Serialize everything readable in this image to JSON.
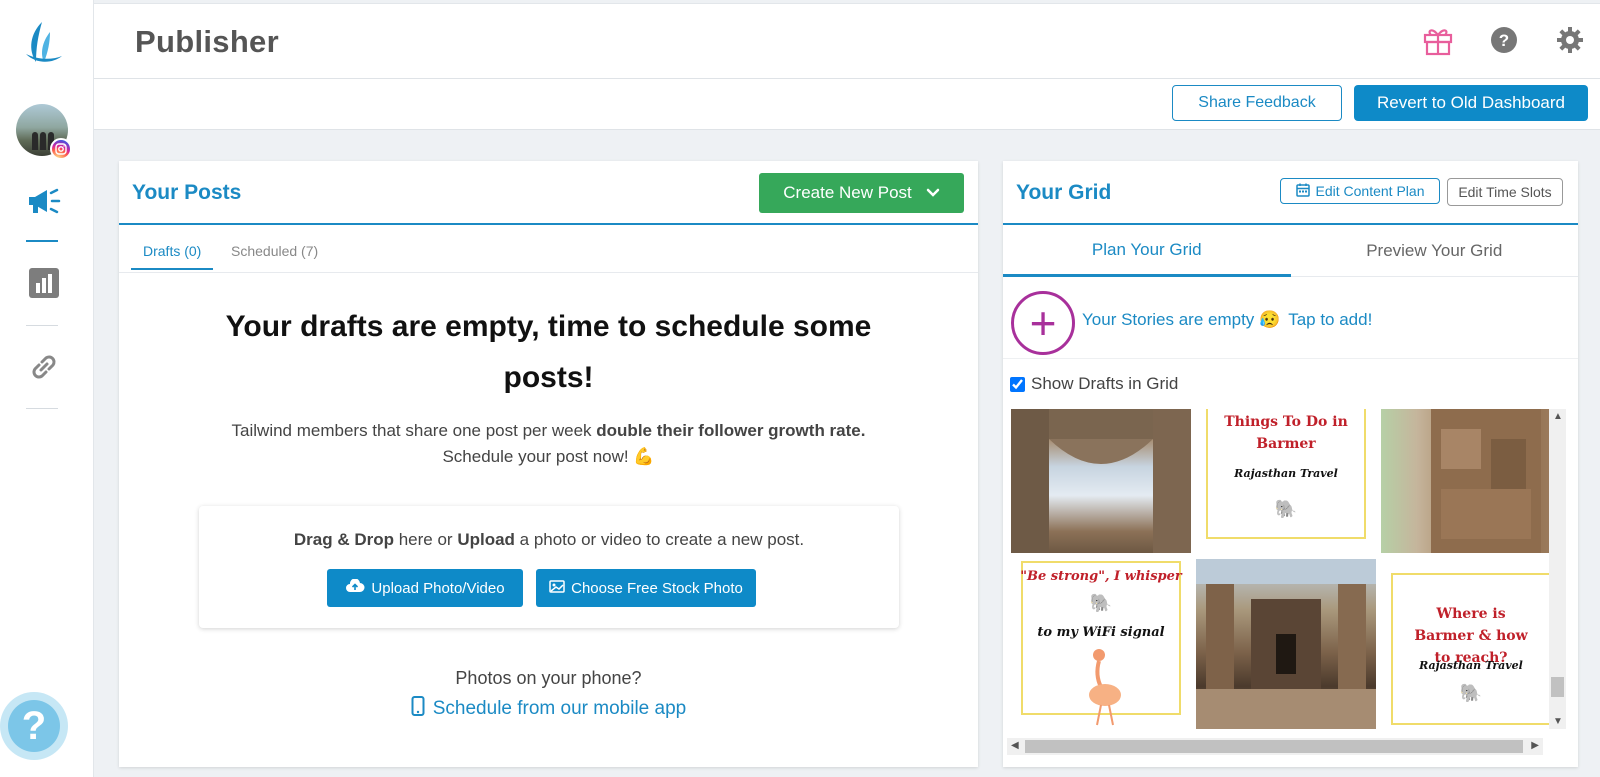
{
  "header": {
    "title": "Publisher",
    "share_feedback": "Share Feedback",
    "revert": "Revert to Old Dashboard"
  },
  "posts": {
    "title": "Your Posts",
    "create_button": "Create New Post",
    "tabs": [
      {
        "label": "Drafts (0)",
        "active": true
      },
      {
        "label": "Scheduled (7)",
        "active": false
      }
    ],
    "empty_title": "Your drafts are empty, time to schedule some posts!",
    "sub_prefix": "Tailwind members that share one post per week ",
    "sub_bold": "double their follower growth rate.",
    "sub_line2": "Schedule your post now! 💪",
    "drop_bold1": "Drag & Drop",
    "drop_mid1": " here or ",
    "drop_bold2": "Upload",
    "drop_tail": " a photo or video to create a new post.",
    "upload_button": "Upload Photo/Video",
    "stock_button": "Choose Free Stock Photo",
    "phone_question": "Photos on your phone?",
    "mobile_link": "Schedule from our mobile app"
  },
  "grid": {
    "title": "Your Grid",
    "edit_plan": "Edit Content Plan",
    "edit_slots": "Edit Time Slots",
    "tabs": [
      {
        "label": "Plan Your Grid",
        "active": true
      },
      {
        "label": "Preview Your Grid",
        "active": false
      }
    ],
    "stories_empty": "Your Stories are empty 😥",
    "stories_tap": "Tap to add!",
    "show_drafts": "Show Drafts in Grid",
    "show_drafts_checked": true,
    "tiles": [
      {
        "kind": "photo",
        "style": "stone1"
      },
      {
        "kind": "card",
        "title": "Things To Do in Barmer",
        "subtitle": "Rajasthan Travel"
      },
      {
        "kind": "photo",
        "style": "stone2"
      },
      {
        "kind": "card",
        "title": "\"Be strong\", I whisper",
        "subtitle": "to my WiFi signal"
      },
      {
        "kind": "photo",
        "style": "stone3"
      },
      {
        "kind": "card",
        "title": "Where is Barmer & how to reach?",
        "subtitle": "Rajasthan Travel"
      }
    ]
  },
  "colors": {
    "brand_blue": "#1b8ac4",
    "primary_button": "#0e8ac8",
    "green_button": "#36a85a",
    "story_ring": "#a8309b",
    "card_title_red": "#c0202a"
  },
  "icons": [
    "tailwind-logo-icon",
    "instagram-icon",
    "megaphone-icon",
    "analytics-icon",
    "link-icon",
    "help-icon",
    "gift-icon",
    "question-icon",
    "gear-icon",
    "calendar-icon",
    "cloud-upload-icon",
    "image-icon",
    "phone-icon",
    "chevron-down-icon",
    "plus-icon"
  ]
}
